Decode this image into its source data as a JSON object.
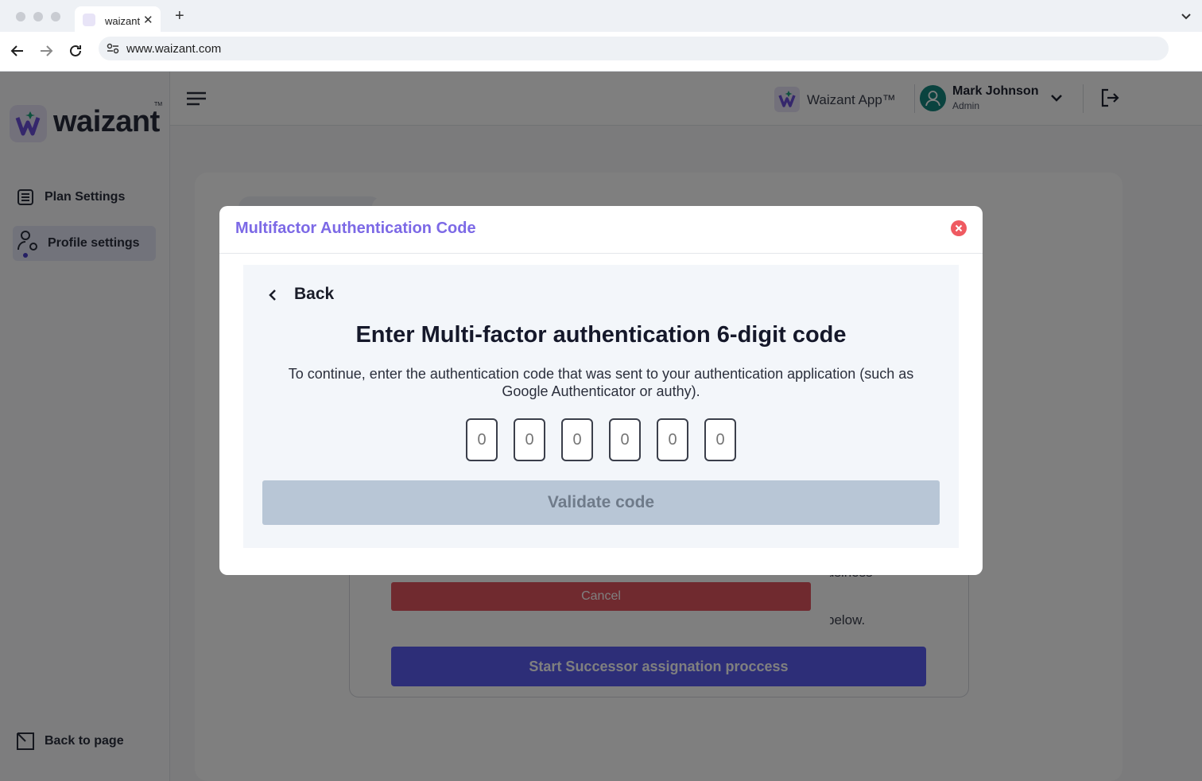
{
  "browser": {
    "tab_title": "waizant",
    "tab_close": "✕",
    "new_tab": "+",
    "url": "www.waizant.com"
  },
  "sidebar": {
    "logo_text": "waizant",
    "logo_tm": "TM",
    "items": [
      {
        "label": "Plan Settings",
        "icon": "list-settings-icon"
      },
      {
        "label": "Profile settings",
        "icon": "user-gear-icon"
      }
    ],
    "back_to_page": "Back to page"
  },
  "topbar": {
    "app_name": "Waizant App™",
    "user_name": "Mark Johnson",
    "user_role": "Admin"
  },
  "background": {
    "start_button": "Start Successor assignation proccess",
    "cancel_button": "Cancel",
    "peek_text_1": "usiness",
    "peek_text_2": "below."
  },
  "mfa_modal": {
    "title": "Multifactor Authentication Code",
    "back_label": "Back",
    "heading": "Enter Multi-factor authentication 6-digit code",
    "description": "To continue, enter the authentication code that was sent to your authentication application (such as Google Authenticator or authy).",
    "code_placeholders": [
      "0",
      "0",
      "0",
      "0",
      "0",
      "0"
    ],
    "validate_button": "Validate code"
  },
  "colors": {
    "accent": "#7c69e6",
    "primary_button": "#5b5cf0",
    "danger": "#e0555e",
    "disabled_button": "#b8c6d6",
    "avatar": "#14867f"
  }
}
